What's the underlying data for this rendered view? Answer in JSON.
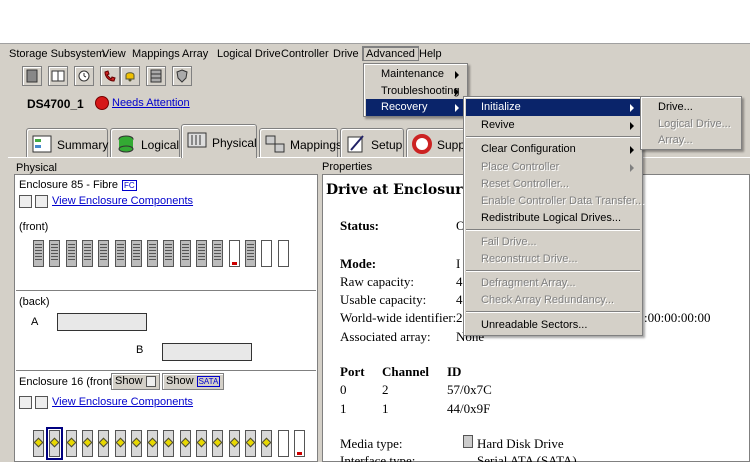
{
  "menubar": {
    "items": [
      "Storage Subsystem",
      "View",
      "Mappings",
      "Array",
      "Logical Drive",
      "Controller",
      "Drive",
      "Advanced",
      "Help"
    ]
  },
  "toolbar": {
    "icons": [
      "storage-icon",
      "document-icon",
      "clock-icon",
      "phone-alert-icon",
      "bell-icon",
      "server-icon",
      "shield-icon"
    ]
  },
  "subsystem": {
    "name": "DS4700_1",
    "status": "Needs Attention"
  },
  "tabs": [
    "Summary",
    "Logical",
    "Physical",
    "Mappings",
    "Setup",
    "Supp"
  ],
  "physical": {
    "title": "Physical",
    "enclosure1": {
      "label": "Enclosure 85 - Fibre",
      "badge": "FC",
      "link": "View Enclosure Components",
      "front": "(front)",
      "back": "(back)",
      "ctrl_a": "A",
      "ctrl_b": "B"
    },
    "enclosure2": {
      "label": "Enclosure 16 (front)-",
      "show1": "Show",
      "show2": "Show",
      "badge": "SATA",
      "link": "View Enclosure Components"
    }
  },
  "properties": {
    "title": "Properties",
    "heading": "Drive at Enclosure 1",
    "status_label": "Status:",
    "status_value": "O",
    "mode_label": "Mode:",
    "mode_value": "I",
    "raw_label": "Raw capacity:",
    "raw_value": "4",
    "usable_label": "Usable capacity:",
    "usable_value": "4",
    "wwid_label": "World-wide identifier:",
    "wwid_value": "2",
    "wwid_tail": ":00:00:00:00",
    "assoc_label": "Associated array:",
    "assoc_value": "None",
    "ports_header": [
      "Port",
      "Channel",
      "ID"
    ],
    "ports": [
      [
        "0",
        "2",
        "57/0x7C"
      ],
      [
        "1",
        "1",
        "44/0x9F"
      ]
    ],
    "media_label": "Media type:",
    "media_value": "Hard Disk Drive",
    "iface_label": "Interface type:",
    "iface_value": "Serial ATA (SATA)"
  },
  "advanced_menu": {
    "items": [
      "Maintenance",
      "Troubleshooting",
      "Recovery"
    ]
  },
  "recovery_menu": {
    "items": [
      "Initialize",
      "Revive",
      "Clear Configuration",
      "Place Controller",
      "Reset Controller...",
      "Enable Controller Data Transfer...",
      "Redistribute Logical Drives...",
      "Fail Drive...",
      "Reconstruct Drive...",
      "Defragment Array...",
      "Check Array Redundancy...",
      "Unreadable Sectors..."
    ]
  },
  "initialize_menu": {
    "items": [
      "Drive...",
      "Logical Drive...",
      "Array..."
    ]
  },
  "colors": {
    "highlight": "#0a246a",
    "link": "#0000cc",
    "alert": "#d61818"
  }
}
